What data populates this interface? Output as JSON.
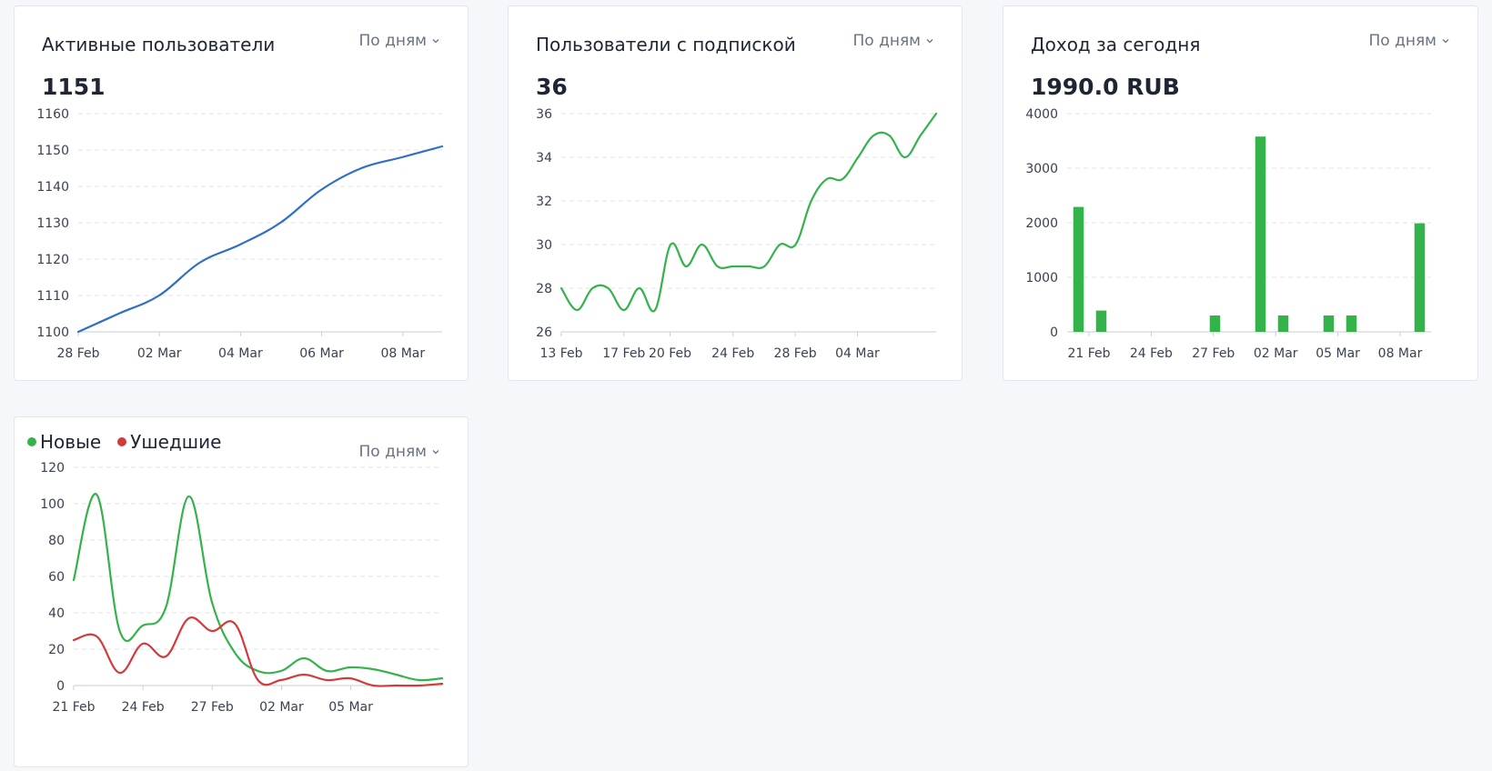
{
  "colors": {
    "blue": "#2f6fc6",
    "green": "#34b34a",
    "red": "#d33a3a",
    "grid": "#dfe3ea"
  },
  "period_label": "По дням",
  "cards": [
    {
      "title": "Активные пользователи",
      "value": "1151",
      "period": "По дням",
      "chart_data": {
        "type": "line",
        "ylim": [
          1100,
          1160
        ],
        "y_ticks": [
          "1100",
          "1110",
          "1120",
          "1130",
          "1140",
          "1150",
          "1160"
        ],
        "x_ticks": [
          "28 Feb",
          "02 Mar",
          "04 Mar",
          "06 Mar",
          "08 Mar"
        ],
        "series": [
          {
            "color": "#2f6fc6",
            "values": [
              1100,
              1105,
              1110,
              1119,
              1124,
              1130,
              1139,
              1145,
              1148,
              1151
            ]
          }
        ]
      }
    },
    {
      "title": "Пользователи с подпиской",
      "value": "36",
      "period": "По дням",
      "chart_data": {
        "type": "line",
        "ylim": [
          26,
          36
        ],
        "y_ticks": [
          "26",
          "28",
          "30",
          "32",
          "34",
          "36"
        ],
        "x_ticks": [
          "13 Feb",
          "17 Feb",
          "20 Feb",
          "24 Feb",
          "28 Feb",
          "04 Mar"
        ],
        "series": [
          {
            "color": "#34b34a",
            "values": [
              28,
              27,
              28,
              28,
              27,
              28,
              27,
              30,
              29,
              30,
              29,
              29,
              29,
              29,
              30,
              30,
              32,
              33,
              33,
              34,
              35,
              35,
              34,
              35,
              36
            ]
          }
        ]
      }
    },
    {
      "title": "Доход за сегодня",
      "value": "1990.0 RUB",
      "period": "По дням",
      "chart_data": {
        "type": "bar",
        "ylim": [
          0,
          4000
        ],
        "y_ticks": [
          "0",
          "1000",
          "2000",
          "3000",
          "4000"
        ],
        "x_ticks": [
          "21 Feb",
          "24 Feb",
          "27 Feb",
          "02 Mar",
          "05 Mar",
          "08 Mar"
        ],
        "series": [
          {
            "color": "#34b34a",
            "values": [
              2290,
              390,
              0,
              0,
              0,
              0,
              300,
              0,
              3580,
              300,
              0,
              300,
              300,
              0,
              0,
              1990
            ]
          }
        ]
      }
    },
    {
      "period": "По дням",
      "legend": [
        {
          "label": "Новые",
          "color": "#34b34a"
        },
        {
          "label": "Ушедшие",
          "color": "#d33a3a"
        }
      ],
      "chart_data": {
        "type": "line",
        "ylim": [
          0,
          120
        ],
        "y_ticks": [
          "0",
          "20",
          "40",
          "60",
          "80",
          "100",
          "120"
        ],
        "x_ticks": [
          "21 Feb",
          "24 Feb",
          "27 Feb",
          "02 Mar",
          "05 Mar"
        ],
        "series": [
          {
            "name": "Новые",
            "color": "#34b34a",
            "values": [
              58,
              105,
              30,
              33,
              43,
              104,
              46,
              18,
              8,
              8,
              15,
              8,
              10,
              9,
              6,
              3,
              4
            ]
          },
          {
            "name": "Ушедшие",
            "color": "#d33a3a",
            "values": [
              25,
              27,
              7,
              23,
              16,
              37,
              30,
              34,
              3,
              3,
              6,
              3,
              4,
              0,
              0,
              0,
              1
            ]
          }
        ]
      }
    }
  ]
}
